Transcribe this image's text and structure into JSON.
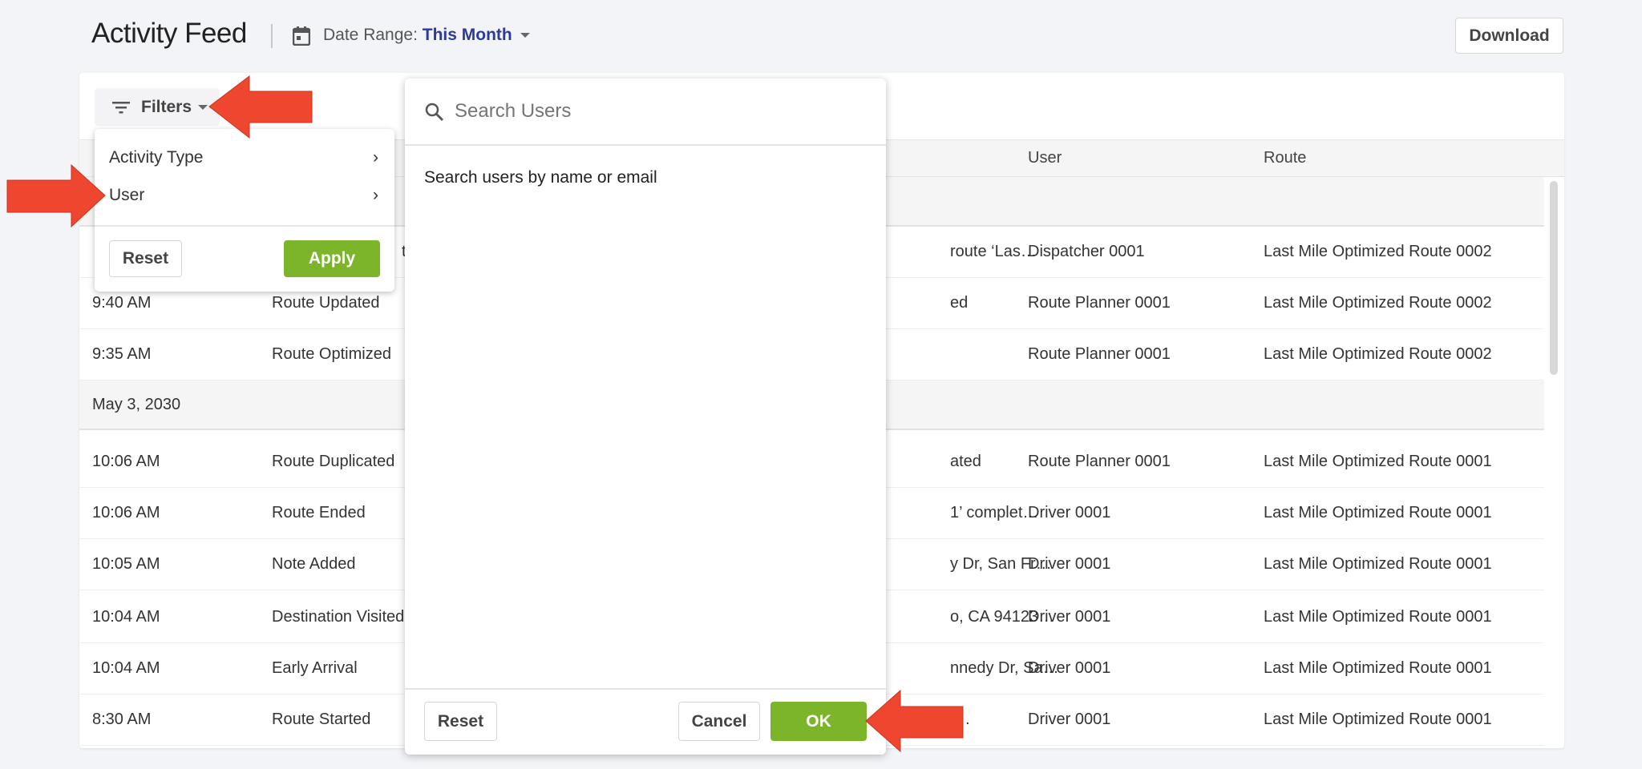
{
  "header": {
    "title": "Activity Feed",
    "date_range_label": "Date Range:",
    "date_range_value": "This Month",
    "download": "Download"
  },
  "toolbar": {
    "filters": "Filters"
  },
  "table": {
    "columns": [
      "User",
      "Route"
    ],
    "rows": [
      {
        "type": "group",
        "date": ""
      },
      {
        "time": "",
        "activity": "t",
        "description": "route ‘Las…",
        "user": "Dispatcher 0001",
        "route": "Last Mile Optimized Route 0002"
      },
      {
        "time": "9:40 AM",
        "activity": "Route Updated",
        "description": "ed",
        "user": "Route Planner 0001",
        "route": "Last Mile Optimized Route 0002"
      },
      {
        "time": "9:35 AM",
        "activity": "Route Optimized",
        "description": "",
        "user": "Route Planner 0001",
        "route": "Last Mile Optimized Route 0002"
      },
      {
        "type": "group",
        "date": "May 3, 2030"
      },
      {
        "time": "10:06 AM",
        "activity": "Route Duplicated",
        "description": "ated",
        "user": "Route Planner 0001",
        "route": "Last Mile Optimized Route 0001"
      },
      {
        "time": "10:06 AM",
        "activity": "Route Ended",
        "description": "1’ complet…",
        "user": "Driver 0001",
        "route": "Last Mile Optimized Route 0001"
      },
      {
        "time": "10:05 AM",
        "activity": "Note Added",
        "description": "y Dr, San Fr…",
        "user": "Driver 0001",
        "route": "Last Mile Optimized Route 0001"
      },
      {
        "time": "10:04 AM",
        "activity": "Destination Visited",
        "description": "o, CA 94123…",
        "user": "Driver 0001",
        "route": "Last Mile Optimized Route 0001"
      },
      {
        "time": "10:04 AM",
        "activity": "Early Arrival",
        "description": "nnedy Dr, Sa…",
        "user": "Driver 0001",
        "route": "Last Mile Optimized Route 0001"
      },
      {
        "time": "8:30 AM",
        "activity": "Route Started",
        "description": "f…",
        "user": "Driver 0001",
        "route": "Last Mile Optimized Route 0001"
      }
    ]
  },
  "filter_menu": {
    "items": [
      "Activity Type",
      "User"
    ],
    "reset": "Reset",
    "apply": "Apply"
  },
  "user_panel": {
    "placeholder": "Search Users",
    "hint": "Search users by name or email",
    "reset": "Reset",
    "cancel": "Cancel",
    "ok": "OK"
  },
  "colors": {
    "accent_green": "#7db52a",
    "link_blue": "#2d3a9c",
    "annotation_arrow": "#ef4630"
  }
}
